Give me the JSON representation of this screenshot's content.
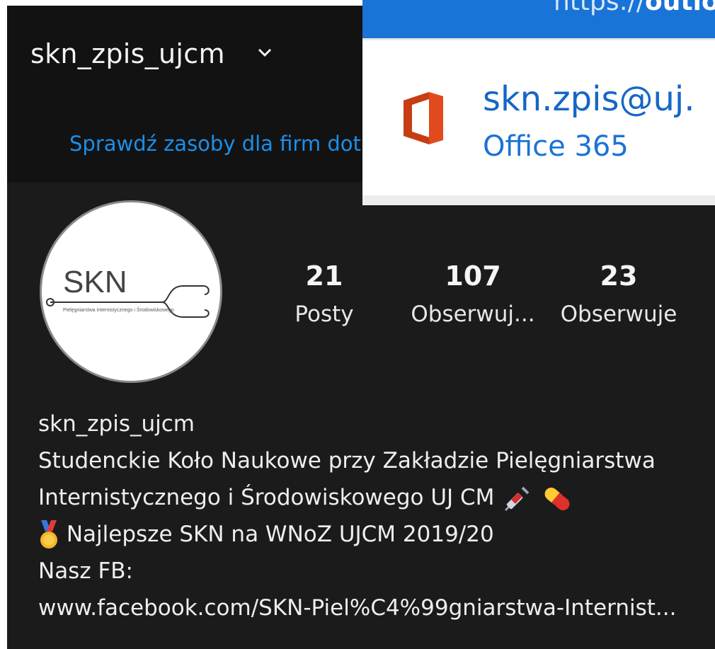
{
  "instagram": {
    "username": "skn_zpis_ujcm",
    "promo_text": "Sprawdź zasoby dla firm dotk",
    "avatar": {
      "logo_text": "SKN",
      "logo_subtext": "Pielęgniarstwa Internistycznego i Środowiskowego"
    },
    "stats": [
      {
        "value": "21",
        "label": "Posty"
      },
      {
        "value": "107",
        "label": "Obserwuj..."
      },
      {
        "value": "23",
        "label": "Obserwuje"
      }
    ],
    "bio": {
      "name": "skn_zpis_ujcm",
      "line1": "Studenckie Koło Naukowe przy Zakładzie Pielęgniarstwa",
      "line2": "Internistycznego i Środowiskowego UJ CM",
      "line3": "Najlepsze SKN na WNoZ UJCM 2019/20",
      "line4": "Nasz FB:",
      "link": "www.facebook.com/SKN-Piel%C4%99gniarstwa-Internist..."
    }
  },
  "outlook": {
    "url_prefix": "https://",
    "url_host": "outlo",
    "email": "skn.zpis@uj.",
    "product": "Office 365"
  },
  "colors": {
    "ig_background": "#1b1b1c",
    "ig_link_blue": "#1d8fe8",
    "outlook_blue": "#1a73d6",
    "office_orange": "#e04a1c"
  }
}
